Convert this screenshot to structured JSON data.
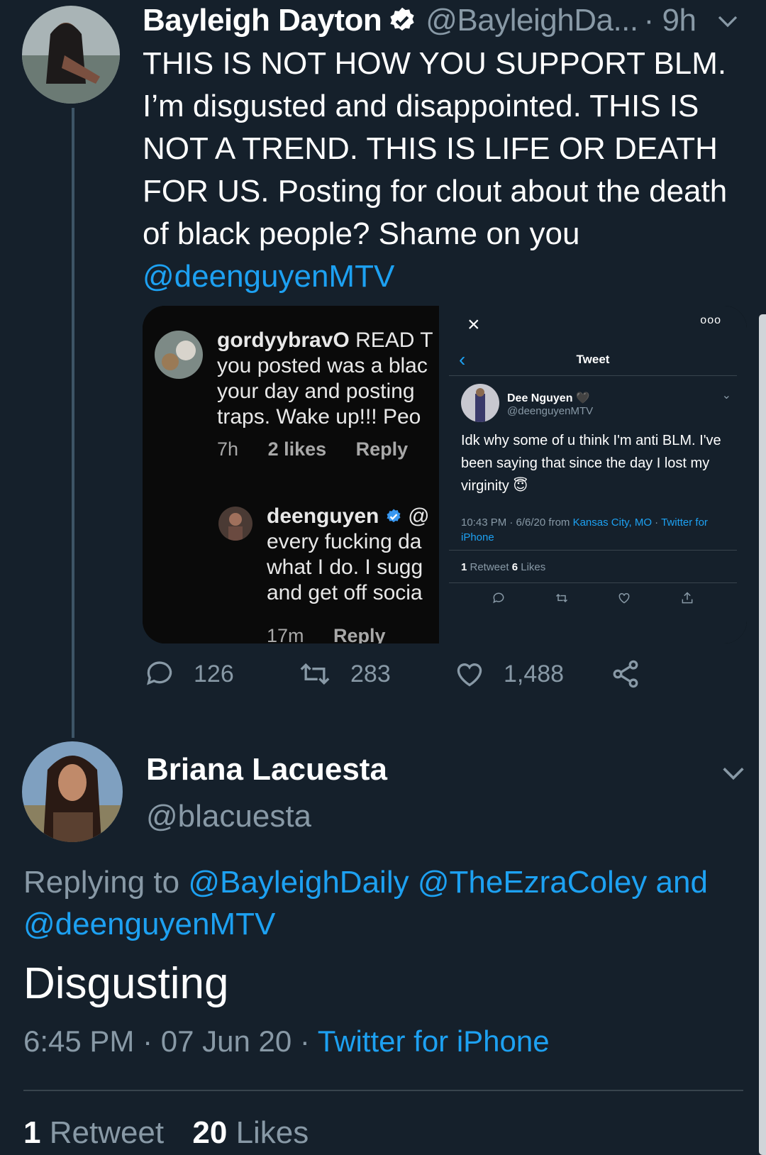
{
  "tweet1": {
    "name": "Bayleigh Dayton",
    "handle": "@BayleighDa...",
    "time": "· 9h",
    "text": "THIS IS NOT HOW YOU SUPPORT BLM. I’m disgusted and disappointed. THIS IS NOT A TREND. THIS IS LIFE OR DEATH FOR US. Posting for clout about the death of black people? Shame on you",
    "mention": "@deenguyenMTV",
    "replies": "126",
    "retweets": "283",
    "likes": "1,488"
  },
  "media": {
    "ig": {
      "c1_user": "gordyybravO",
      "c1_line1": "READ T",
      "c1_line2": "you posted was a blac",
      "c1_line3": "your day and posting",
      "c1_line4": "traps. Wake up!!! Peo",
      "c1_time": "7h",
      "c1_likes": "2 likes",
      "c1_reply": "Reply",
      "c2_user": "deenguyen",
      "c2_at": "@",
      "c2_line2": "every fucking da",
      "c2_line3": "what I do. I sugg",
      "c2_line4": "and get off socia",
      "c2_time": "17m",
      "c2_reply": "Reply"
    },
    "tw": {
      "close": "×",
      "more": "ooo",
      "back": "‹",
      "title": "Tweet",
      "name": "Dee Nguyen 🖤",
      "handle": "@deenguyenMTV",
      "body": "Idk why some of u think I'm anti BLM. I've been saying that since the day I lost my virginity 😇",
      "meta_time": "10:43 PM · 6/6/20 from ",
      "meta_loc": "Kansas City, MO",
      "meta_sep": " · ",
      "meta_src": "Twitter for iPhone",
      "rt_count": "1",
      "rt_label": " Retweet  ",
      "like_count": "6",
      "like_label": " Likes"
    }
  },
  "tweet2": {
    "name": "Briana Lacuesta",
    "handle": "@blacuesta",
    "replying_label": "Replying to ",
    "replying_m1": "@BayleighDaily",
    "replying_m2": "@TheEzraColey",
    "replying_and": "and",
    "replying_m3": "@deenguyenMTV",
    "text": "Disgusting",
    "time": "6:45 PM · 07 Jun 20 · ",
    "source": "Twitter for iPhone",
    "retweet_count": "1",
    "retweet_label": "Retweet",
    "like_count": "20",
    "like_label": "Likes"
  },
  "colors": {
    "background": "#15202b",
    "accent": "#1da1f2",
    "secondary_text": "#8899a6"
  }
}
